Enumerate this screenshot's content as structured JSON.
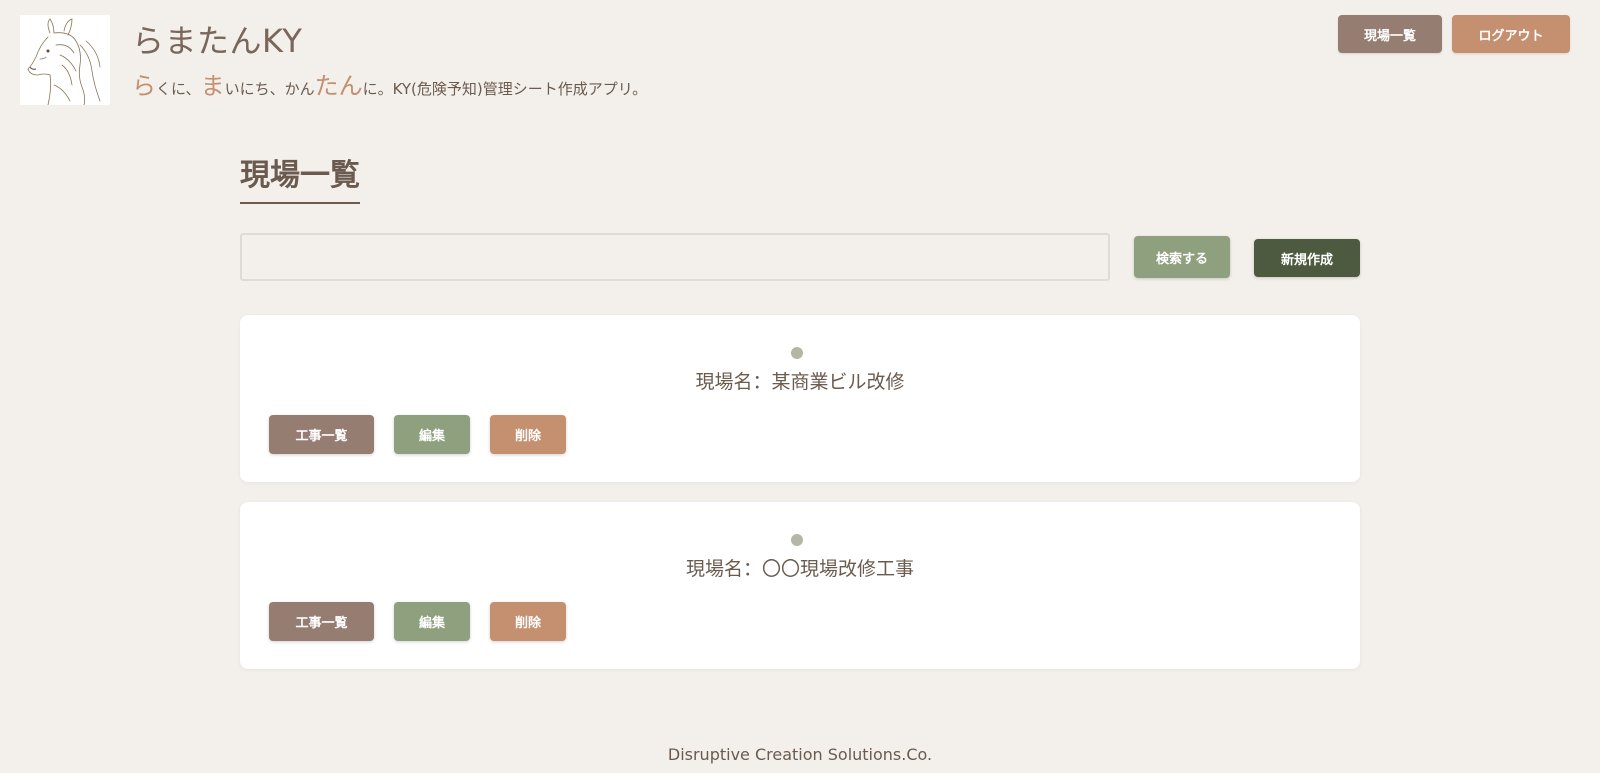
{
  "header": {
    "app_title": "らまたんKY",
    "tagline": {
      "seg1_big": "ら",
      "seg1": "くに、",
      "seg2_big": "ま",
      "seg2": "いにち、かん",
      "seg3_big": "たん",
      "seg3": "に。KY(危険予知)管理シート作成アプリ。"
    },
    "nav_sites_label": "現場一覧",
    "logout_label": "ログアウト"
  },
  "main": {
    "page_title": "現場一覧",
    "search": {
      "value": "",
      "placeholder": ""
    },
    "search_button_label": "検索する",
    "new_button_label": "新規作成"
  },
  "sites": [
    {
      "name": "現場名：某商業ビル改修",
      "works_label": "工事一覧",
      "edit_label": "編集",
      "delete_label": "削除"
    },
    {
      "name": "現場名：〇〇現場改修工事",
      "works_label": "工事一覧",
      "edit_label": "編集",
      "delete_label": "削除"
    }
  ],
  "footer": {
    "company": "Disruptive Creation Solutions.Co."
  },
  "colors": {
    "background": "#f3f0ec",
    "text": "#6b5a4e",
    "accent_mauve": "#957d72",
    "accent_terracotta": "#c4906f",
    "accent_sage": "#8fa07e",
    "accent_dark_olive": "#4e5a40"
  },
  "icons": {
    "logo": "alpaca-logo-icon",
    "bullet": "dot-icon"
  }
}
